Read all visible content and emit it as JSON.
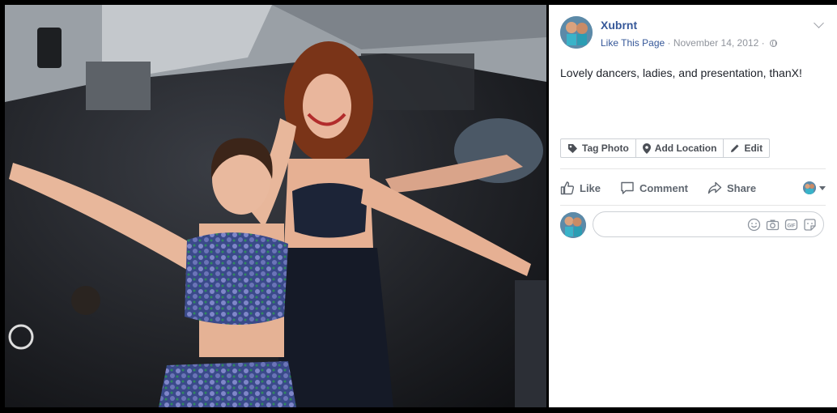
{
  "post": {
    "page_name": "Xubrnt",
    "like_link": "Like This Page",
    "separator": " · ",
    "date": "November 14, 2012",
    "separator2": " · ",
    "text": "Lovely dancers, ladies, and presentation, thanX!"
  },
  "photo_actions": {
    "tag_label": "Tag Photo",
    "location_label": "Add Location",
    "edit_label": "Edit"
  },
  "actions": {
    "like_label": "Like",
    "comment_label": "Comment",
    "share_label": "Share"
  },
  "comment": {
    "placeholder": ""
  },
  "icons": {
    "options": "chevron-down-icon",
    "privacy": "globe-icon",
    "tag": "tag-icon",
    "location": "location-pin-icon",
    "edit": "pencil-icon",
    "like": "thumbs-up-icon",
    "comment": "speech-bubble-icon",
    "share": "share-arrow-icon",
    "emoji": "smiley-icon",
    "camera": "camera-icon",
    "gif": "gif-icon",
    "sticker": "sticker-icon"
  },
  "colors": {
    "link": "#365899",
    "meta": "#90949c",
    "text": "#1d2129",
    "action": "#606770"
  }
}
